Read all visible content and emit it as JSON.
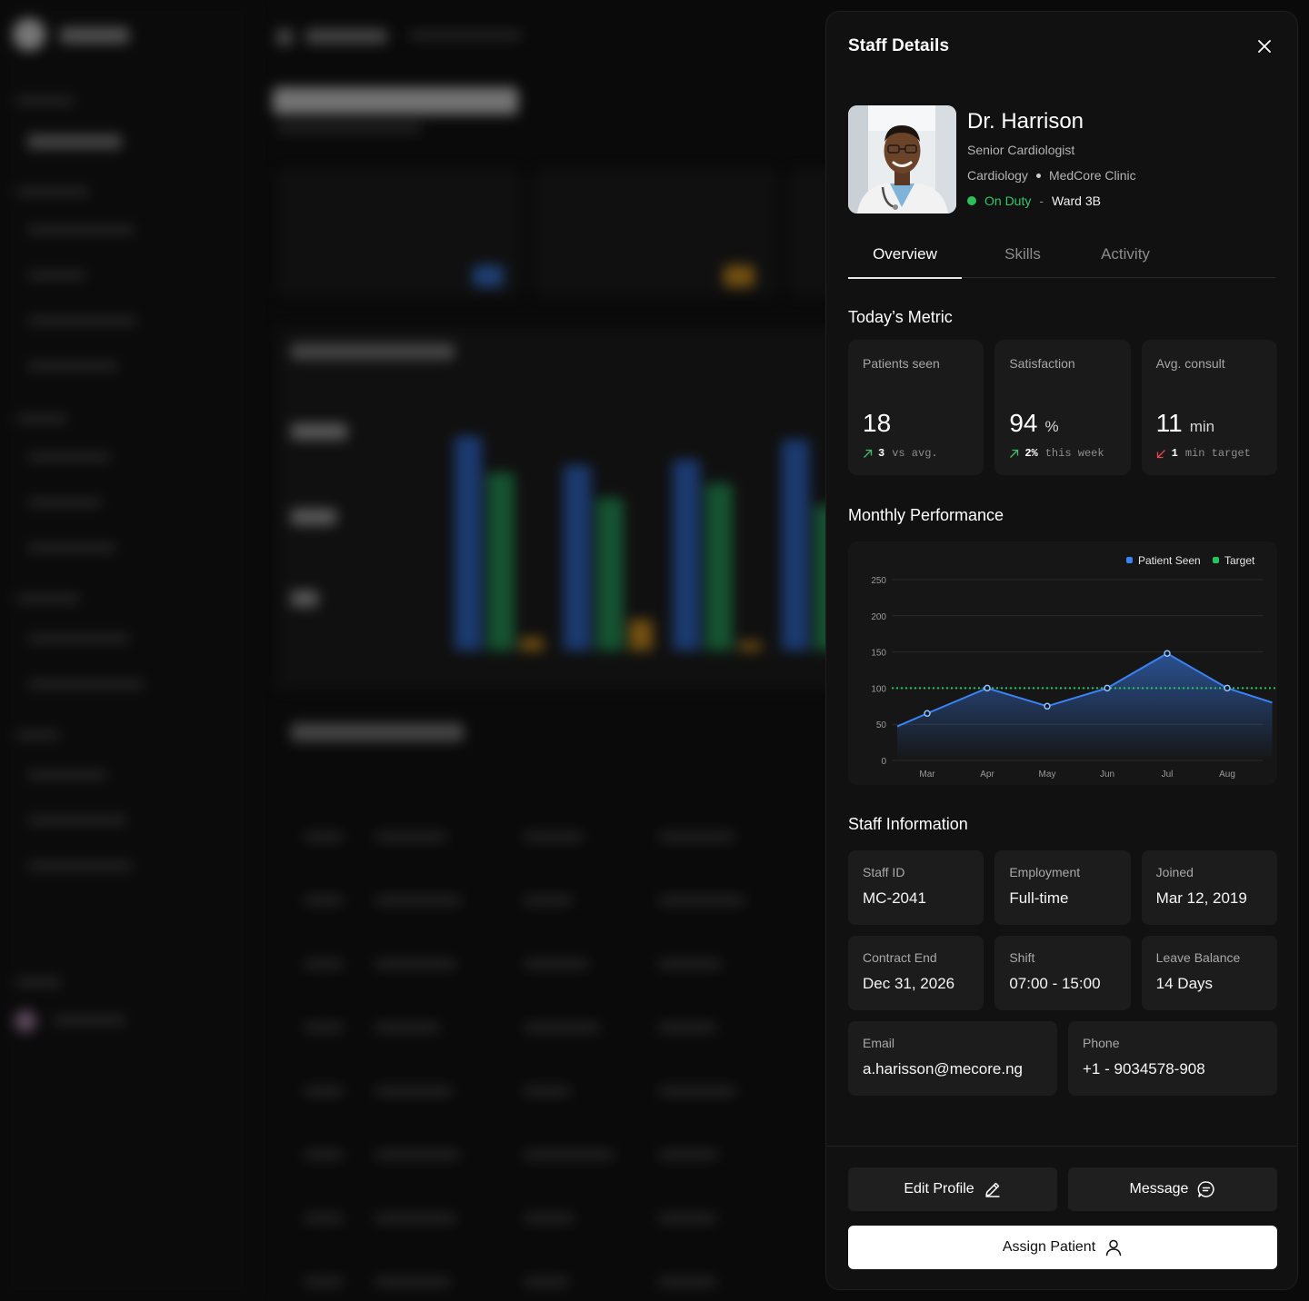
{
  "panel": {
    "title": "Staff Details"
  },
  "profile": {
    "name": "Dr. Harrison",
    "role": "Senior Cardiologist",
    "department": "Cardiology",
    "clinic": "MedCore Clinic",
    "status": "On Duty",
    "status_separator": "-",
    "ward": "Ward 3B",
    "status_color": "#36c76a"
  },
  "tabs": [
    {
      "label": "Overview",
      "active": true
    },
    {
      "label": "Skills",
      "active": false
    },
    {
      "label": "Activity",
      "active": false
    }
  ],
  "metrics_section": {
    "title": "Today’s Metric",
    "items": [
      {
        "label": "Patients seen",
        "value": "18",
        "unit": "",
        "delta": "3",
        "delta_text": "vs avg.",
        "trend": "up",
        "trend_color": "#3fbf6a"
      },
      {
        "label": "Satisfaction",
        "value": "94",
        "unit": "%",
        "delta": "2%",
        "delta_text": "this week",
        "trend": "up",
        "trend_color": "#3fbf6a"
      },
      {
        "label": "Avg. consult",
        "value": "11",
        "unit": "min",
        "delta": "1",
        "delta_text": "min target",
        "trend": "down",
        "trend_color": "#e5484d"
      }
    ]
  },
  "performance": {
    "title": "Monthly Performance"
  },
  "chart_data": {
    "type": "line",
    "title": "",
    "xlabel": "",
    "ylabel": "",
    "categories": [
      "Mar",
      "Apr",
      "May",
      "Jun",
      "Jul",
      "Aug"
    ],
    "y_ticks": [
      250,
      200,
      150,
      100,
      50,
      0
    ],
    "ylim": [
      0,
      250
    ],
    "grid": true,
    "legend_position": "top-right",
    "series": [
      {
        "name": "Patient Seen",
        "color": "#3b82f6",
        "x": [
          2.5,
          3,
          4,
          5,
          6,
          7,
          8,
          8.75
        ],
        "values": [
          47,
          65,
          100,
          75,
          100,
          148,
          100,
          80
        ]
      },
      {
        "name": "Target",
        "color": "#22c55e",
        "values": [
          100,
          100,
          100,
          100,
          100,
          100
        ]
      }
    ]
  },
  "staff_info": {
    "title": "Staff Information",
    "rows": [
      [
        {
          "label": "Staff ID",
          "value": "MC-2041"
        },
        {
          "label": "Employment",
          "value": "Full-time"
        },
        {
          "label": "Joined",
          "value": "Mar 12, 2019"
        }
      ],
      [
        {
          "label": "Contract End",
          "value": "Dec 31, 2026"
        },
        {
          "label": "Shift",
          "value": "07:00 - 15:00"
        },
        {
          "label": "Leave Balance",
          "value": "14 Days"
        }
      ],
      [
        {
          "label": "Email",
          "value": "a.harisson@mecore.ng"
        },
        {
          "label": "Phone",
          "value": "+1 - 9034578-908"
        }
      ]
    ]
  },
  "actions": {
    "edit_label": "Edit Profile",
    "message_label": "Message",
    "assign_label": "Assign Patient"
  }
}
